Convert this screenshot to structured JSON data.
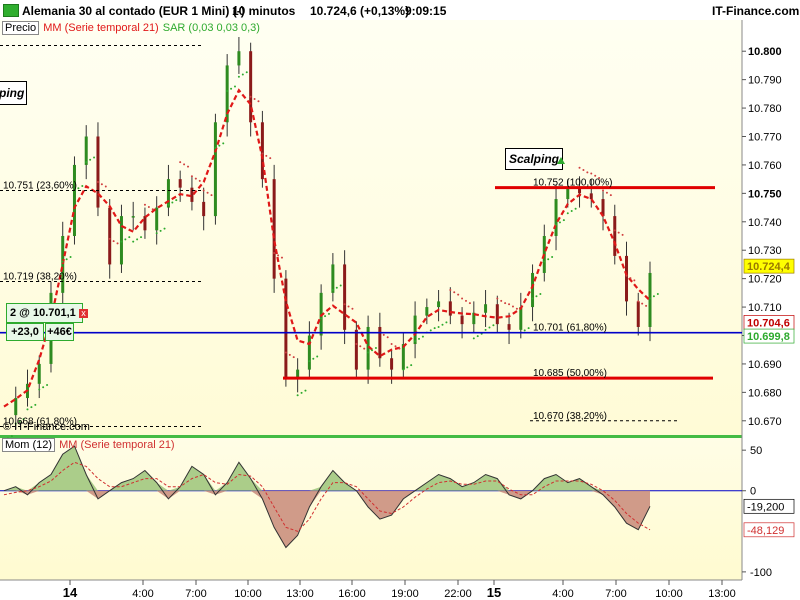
{
  "window": {
    "instrument": "Alemania 30 al contado (EUR 1 Mini) (-)",
    "timeframe": "10 minutos",
    "last_price": "10.724,6 (+0,13%)",
    "time": "9:09:15",
    "brand": "IT-Finance.com"
  },
  "price_panel": {
    "legend": {
      "price": "Precio",
      "ma": "MM (Serie temporal 21)",
      "sar": "SAR (0,03 0,03 0,3)"
    },
    "watermark": "© IT-Finance.com",
    "scalping_label_left": "ping",
    "scalping_label": "Scalping",
    "position_label": "2 @ 10.701,1",
    "position_close": "x",
    "pnl_points": "+23,0",
    "pnl_money": "+46€",
    "colors": {
      "bull_candle": "#2e8b20",
      "bear_candle": "#8b1a1a",
      "ma": "#e01818",
      "sar": "#2eaa2e",
      "resistance": "#e00000",
      "support_blue": "#0000c8",
      "bg_top": "#fffff0",
      "bg_bottom": "#fffbd8"
    },
    "price_tags": [
      {
        "label": "10.724,4",
        "color": "#9a7a00",
        "bg": "#ffff00"
      },
      {
        "label": "10.704,6",
        "color": "#c00000",
        "bg": "#ffffff"
      },
      {
        "label": "10.699,8",
        "color": "#2eaa2e",
        "bg": "#ffffff"
      }
    ]
  },
  "momentum_panel": {
    "legend": {
      "mom": "Mom (12)",
      "ma": "MM (Serie temporal 21)"
    },
    "value_tags": [
      {
        "label": "-19,200",
        "color": "#000000"
      },
      {
        "label": "-48,129",
        "color": "#d03030"
      }
    ]
  },
  "chart_data": [
    {
      "type": "candlestick",
      "title": "Alemania 30 al contado (EUR 1 Mini) (-)",
      "ylim": [
        10665,
        10805
      ],
      "y_ticks": [
        "10.800",
        "10.790",
        "10.780",
        "10.770",
        "10.760",
        "10.750",
        "10.740",
        "10.730",
        "10.720",
        "10.710",
        "10.700",
        "10.690",
        "10.680",
        "10.670"
      ],
      "y_tick_values": [
        10800,
        10790,
        10780,
        10770,
        10760,
        10750,
        10740,
        10730,
        10720,
        10710,
        10700,
        10690,
        10680,
        10670
      ],
      "x_ticks": [
        "14",
        "4:00",
        "7:00",
        "10:00",
        "13:00",
        "16:00",
        "19:00",
        "22:00",
        "15",
        "4:00",
        "7:00",
        "10:00",
        "13:00"
      ],
      "x_ticks_bold": [
        true,
        false,
        false,
        false,
        false,
        false,
        false,
        false,
        true,
        false,
        false,
        false,
        false
      ],
      "series_shape": [
        10672,
        10678,
        10683,
        10690,
        10715,
        10735,
        10760,
        10770,
        10745,
        10725,
        10742,
        10742,
        10737,
        10745,
        10755,
        10752,
        10747,
        10742,
        10775,
        10795,
        10800,
        10775,
        10755,
        10720,
        10685,
        10688,
        10700,
        10715,
        10725,
        10702,
        10688,
        10703,
        10692,
        10688,
        10697,
        10707,
        10710,
        10712,
        10707,
        10704,
        10708,
        10711,
        10704,
        10702,
        10710,
        10722,
        10735,
        10748,
        10752,
        10750,
        10748,
        10742,
        10728,
        10712,
        10703,
        10722
      ],
      "fib_levels": [
        {
          "label": "10.751 (23,60%)",
          "value": 10751
        },
        {
          "label": "10.719 (38,20%)",
          "value": 10719
        },
        {
          "label": "10.668 (61,80%)",
          "value": 10668
        },
        {
          "label": "10.752 (100,00%)",
          "value": 10752
        },
        {
          "label": "10.701 (61,80%)",
          "value": 10701
        },
        {
          "label": "10.685 (50,00%)",
          "value": 10685
        },
        {
          "label": "10.670 (38,20%)",
          "value": 10670
        }
      ],
      "horizontal_lines": [
        {
          "value": 10752,
          "color": "#e00000"
        },
        {
          "value": 10701,
          "color": "#0000c8"
        },
        {
          "value": 10685,
          "color": "#e00000"
        }
      ],
      "last_close": 10724.4
    },
    {
      "type": "area",
      "title": "Mom (12)",
      "ylim": [
        -110,
        65
      ],
      "y_ticks": [
        "50",
        "0",
        "-100"
      ],
      "y_tick_values": [
        50,
        0,
        -100
      ],
      "series": [
        {
          "name": "Mom (12)",
          "values": [
            0,
            5,
            -5,
            10,
            20,
            45,
            55,
            20,
            -10,
            0,
            10,
            15,
            25,
            10,
            -10,
            5,
            30,
            20,
            -5,
            10,
            35,
            15,
            -10,
            -45,
            -70,
            -55,
            -20,
            5,
            25,
            10,
            0,
            -20,
            -35,
            -30,
            -10,
            0,
            10,
            20,
            15,
            5,
            10,
            20,
            15,
            -5,
            -10,
            0,
            15,
            20,
            10,
            15,
            5,
            -5,
            -20,
            -40,
            -48,
            -19.2
          ]
        },
        {
          "name": "MM (Serie temporal 21)",
          "values": [
            -5,
            -2,
            0,
            5,
            12,
            25,
            35,
            30,
            15,
            5,
            5,
            10,
            15,
            15,
            5,
            5,
            15,
            20,
            10,
            8,
            20,
            18,
            5,
            -20,
            -45,
            -50,
            -35,
            -10,
            10,
            10,
            5,
            -10,
            -25,
            -28,
            -20,
            -8,
            2,
            10,
            12,
            8,
            8,
            12,
            12,
            2,
            -5,
            -5,
            5,
            12,
            12,
            12,
            8,
            0,
            -12,
            -28,
            -40,
            -48.1
          ]
        }
      ],
      "last_values": {
        "Mom (12)": -19.2,
        "MM (Serie temporal 21)": -48.129
      }
    }
  ]
}
